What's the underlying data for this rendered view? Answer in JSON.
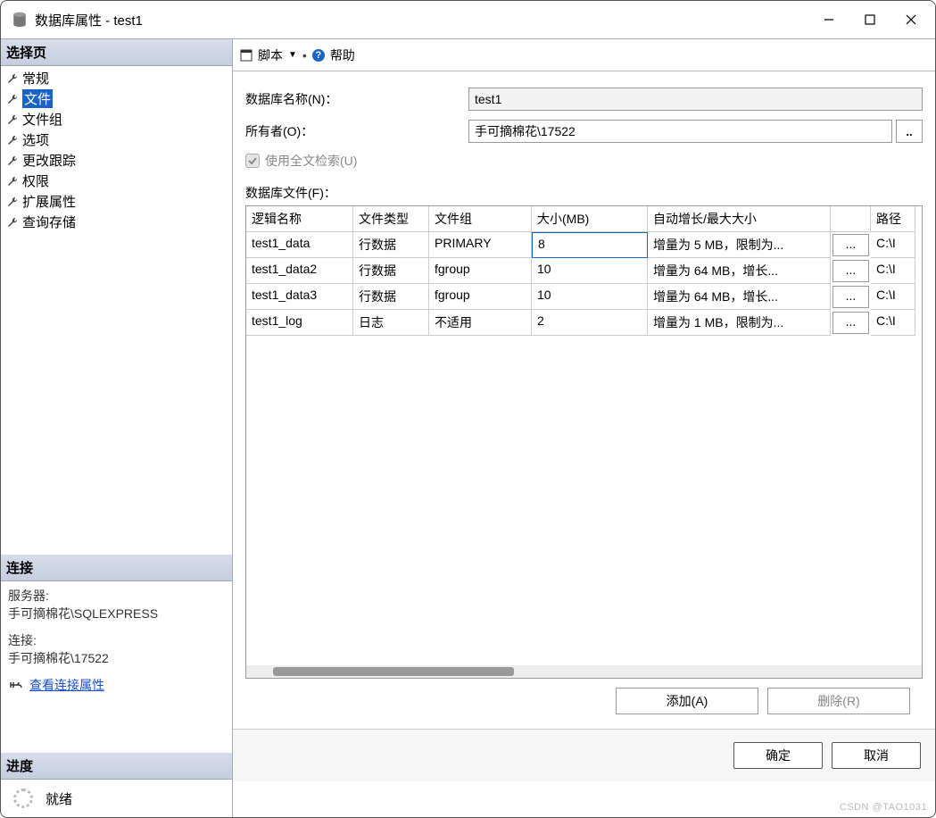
{
  "title": "数据库属性 - test1",
  "sidebar": {
    "header_pages": "选择页",
    "pages": [
      "常规",
      "文件",
      "文件组",
      "选项",
      "更改跟踪",
      "权限",
      "扩展属性",
      "查询存储"
    ],
    "selected_index": 1,
    "header_conn": "连接",
    "server_label": "服务器:",
    "server_value": "手可摘棉花\\SQLEXPRESS",
    "conn_label": "连接:",
    "conn_value": "手可摘棉花\\17522",
    "view_conn_props": "查看连接属性",
    "header_progress": "进度",
    "progress_text": "就绪"
  },
  "toolbar": {
    "script": "脚本",
    "help": "帮助"
  },
  "form": {
    "db_name_label": "数据库名称(N)：",
    "db_name_value": "test1",
    "owner_label": "所有者(O)：",
    "owner_value": "手可摘棉花\\17522",
    "browse_btn": "..",
    "fulltext_label": "使用全文检索(U)",
    "files_label": "数据库文件(F)："
  },
  "grid": {
    "headers": [
      "逻辑名称",
      "文件类型",
      "文件组",
      "大小(MB)",
      "自动增长/最大大小",
      "",
      "路径"
    ],
    "rows": [
      {
        "name": "test1_data",
        "type": "行数据",
        "group": "PRIMARY",
        "size": "8",
        "growth": "增量为 5 MB，限制为...",
        "btn": "...",
        "path": "C:\\I"
      },
      {
        "name": "test1_data2",
        "type": "行数据",
        "group": "fgroup",
        "size": "10",
        "growth": "增量为 64 MB，增长...",
        "btn": "...",
        "path": "C:\\I"
      },
      {
        "name": "test1_data3",
        "type": "行数据",
        "group": "fgroup",
        "size": "10",
        "growth": "增量为 64 MB，增长...",
        "btn": "...",
        "path": "C:\\I"
      },
      {
        "name": "test1_log",
        "type": "日志",
        "group": "不适用",
        "size": "2",
        "growth": "增量为 1 MB，限制为...",
        "btn": "...",
        "path": "C:\\I"
      }
    ],
    "selected_row": 0
  },
  "actions": {
    "add": "添加(A)",
    "remove": "删除(R)"
  },
  "dialog": {
    "ok": "确定",
    "cancel": "取消"
  },
  "watermark": "CSDN @TAO1031"
}
